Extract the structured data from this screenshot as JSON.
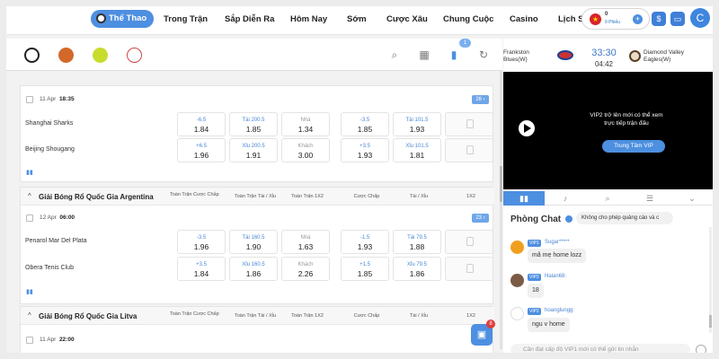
{
  "nav": {
    "items": [
      "Thể Thao",
      "Trong Trận",
      "Sắp Diễn Ra",
      "Hôm Nay",
      "Sớm",
      "Cược Xâu",
      "Chung Cuộc",
      "Casino",
      "Lịch S"
    ],
    "balance_primary": "0",
    "balance_secondary": "0 Phiếu",
    "avatar_letter": "C"
  },
  "toolbar": {
    "notification_count": "1"
  },
  "leagues": [
    {
      "name": "",
      "headers": [],
      "date": "11 Apr",
      "time": "18:35",
      "count": "26",
      "teams": [
        "Shanghai Sharks",
        "Beijing Shougang"
      ],
      "odds": [
        [
          {
            "top": "-6.5",
            "bot": "1.84"
          },
          {
            "top": "Tài 200.5",
            "bot": "1.85"
          },
          {
            "top": "Nhà",
            "bot": "1.34"
          },
          {
            "top": "-3.5",
            "bot": "1.85"
          },
          {
            "top": "Tài 101.5",
            "bot": "1.93"
          }
        ],
        [
          {
            "top": "+6.5",
            "bot": "1.96"
          },
          {
            "top": "Xỉu 200.5",
            "bot": "1.91"
          },
          {
            "top": "Khách",
            "bot": "3.00"
          },
          {
            "top": "+3.5",
            "bot": "1.93"
          },
          {
            "top": "Xỉu 101.5",
            "bot": "1.81"
          }
        ]
      ]
    },
    {
      "name": "Giải Bóng Rổ Quốc Gia Argentina",
      "headers": [
        "Toàn Trận Cược Chấp",
        "Toàn Trận Tài / Xỉu",
        "Toàn Trận 1X2",
        "Cược Chấp",
        "Tài / Xỉu",
        "1X2"
      ],
      "date": "12 Apr",
      "time": "06:00",
      "count": "23",
      "teams": [
        "Penarol Mar Del Plata",
        "Obera Tenis Club"
      ],
      "odds": [
        [
          {
            "top": "-3.5",
            "bot": "1.96"
          },
          {
            "top": "Tài 160.5",
            "bot": "1.90"
          },
          {
            "top": "Nhà",
            "bot": "1.63"
          },
          {
            "top": "-1.5",
            "bot": "1.93"
          },
          {
            "top": "Tài 79.5",
            "bot": "1.88"
          }
        ],
        [
          {
            "top": "+3.5",
            "bot": "1.84"
          },
          {
            "top": "Xỉu 160.5",
            "bot": "1.86"
          },
          {
            "top": "Khách",
            "bot": "2.26"
          },
          {
            "top": "+1.5",
            "bot": "1.85"
          },
          {
            "top": "Xỉu 79.5",
            "bot": "1.86"
          }
        ]
      ]
    },
    {
      "name": "Giải Bóng Rổ Quốc Gia Litva",
      "headers": [
        "Toàn Trận Cược Chấp",
        "Toàn Trận Tài / Xỉu",
        "Toàn Trận 1X2",
        "Cược Chấp",
        "Tài / Xỉu",
        "1X2"
      ],
      "date": "11 Apr",
      "time": "22:00",
      "count": "",
      "teams": [],
      "odds": []
    }
  ],
  "cart_badge": "8",
  "match": {
    "team1": "Frankston Blues(W)",
    "team2": "Diamond Valley Eagles(W)",
    "clock": "33:30",
    "time": "04:42"
  },
  "video": {
    "vip_text": "VIP2 trở lên mới có thể xem trực tiếp trận đấu",
    "vip_button": "Trung Tâm VIP"
  },
  "chat": {
    "title": "Phòng Chat",
    "notice": "Không cho phép quảng cáo và c",
    "messages": [
      {
        "vip": "VIP1",
        "user": "Sugar*****",
        "text": "mã mẹ home lozz",
        "avatar_color": "#f0a020"
      },
      {
        "vip": "VIP2",
        "user": "Halan68:",
        "text": "18",
        "avatar_color": "#7a5b45"
      },
      {
        "vip": "VIP2",
        "user": "hoanglungg:",
        "text": "ngu v home",
        "avatar_color": "#ffffff"
      }
    ],
    "input_placeholder": "Cần đạt cấp độ VIP1 mới có thể gửi tin nhắn"
  },
  "colors": {
    "accent": "#4d8fe0",
    "odds_label": "#4a86d4"
  },
  "icons": [
    "soccer-ball-icon",
    "basketball-icon",
    "tennis-ball-icon",
    "baseball-icon",
    "search-icon",
    "calendar-icon",
    "bookmark-icon",
    "refresh-icon",
    "lock-icon",
    "stats-icon",
    "play-icon",
    "cart-icon"
  ]
}
